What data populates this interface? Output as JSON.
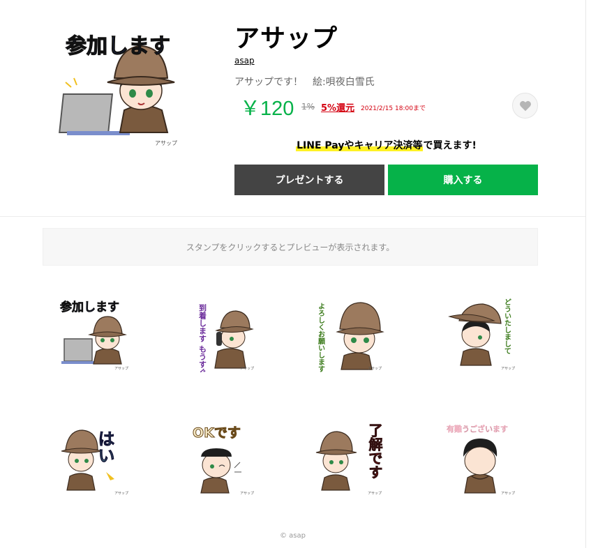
{
  "product": {
    "title": "アサップ",
    "author": "asap",
    "description": "アサップです！",
    "illustrator": "絵:唄夜白雪氏",
    "price": "￥120",
    "old_rate": "1%",
    "cashback": "5%還元",
    "deadline": "2021/2/15 18:00まで",
    "promo_prefix": "LINE Payやキャリア決済等",
    "promo_suffix": "で買えます!",
    "gift_label": "プレゼントする",
    "buy_label": "購入する",
    "accent_color": "#06b249",
    "sale_color": "#d40010"
  },
  "preview_hint": "スタンプをクリックするとプレビューが表示されます。",
  "hero": {
    "caption": "参加します",
    "signature": "アサップ"
  },
  "stickers": [
    {
      "text": "参加します",
      "signature": "アサップ"
    },
    {
      "text": "到着します もうすぐ",
      "signature": "アサップ"
    },
    {
      "text": "よろしくお願いします",
      "signature": "アサップ"
    },
    {
      "text": "どういたしまして",
      "signature": "アサップ"
    },
    {
      "text": "はい",
      "signature": "アサップ"
    },
    {
      "text": "OKです",
      "signature": "アサップ"
    },
    {
      "text": "了解です",
      "signature": "アサップ"
    },
    {
      "text": "有難うございます",
      "signature": "アサップ"
    }
  ],
  "footer": {
    "credit": "© asap"
  }
}
